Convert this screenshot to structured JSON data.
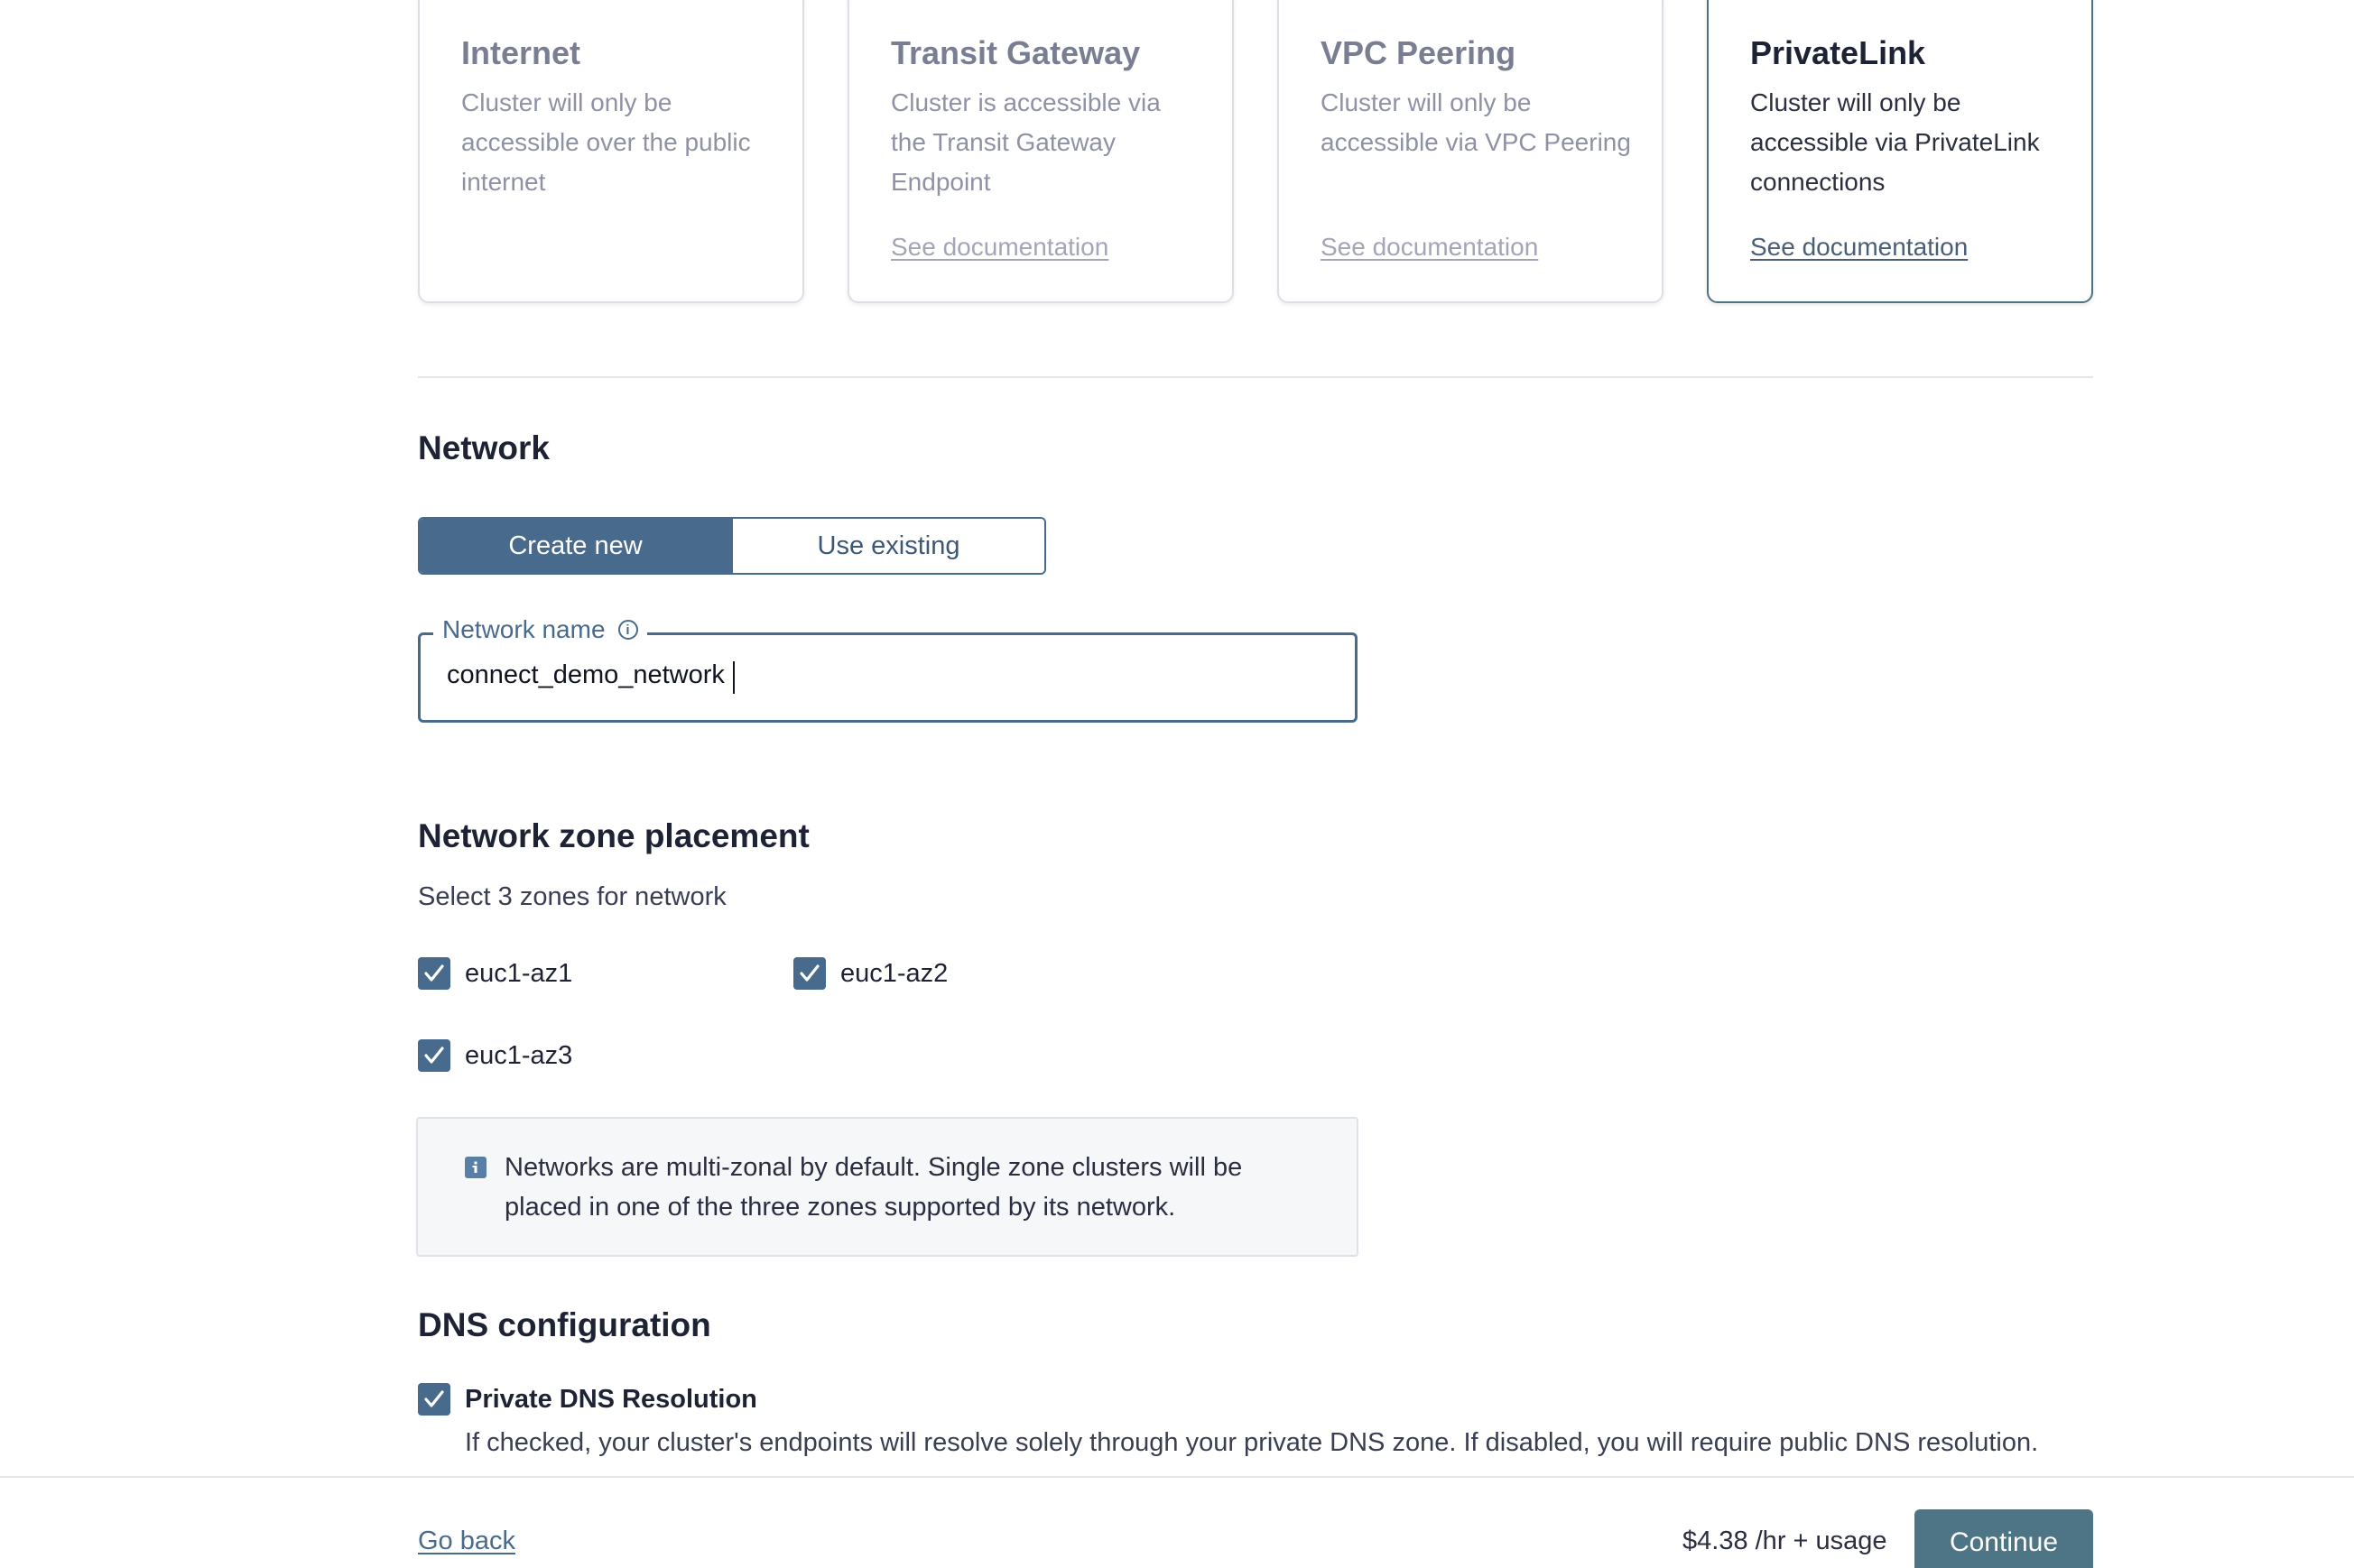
{
  "connectivity": {
    "cards": [
      {
        "title": "Internet",
        "description": "Cluster will only be accessible over the public internet",
        "link": ""
      },
      {
        "title": "Transit Gateway",
        "description": "Cluster is accessible via the Transit Gateway Endpoint",
        "link": "See documentation"
      },
      {
        "title": "VPC Peering",
        "description": "Cluster will only be accessible via VPC Peering",
        "link": "See documentation"
      },
      {
        "title": "PrivateLink",
        "description": "Cluster will only be accessible via PrivateLink connections",
        "link": "See documentation"
      }
    ],
    "selected": "PrivateLink"
  },
  "network": {
    "title": "Network",
    "create_new": "Create new",
    "use_existing": "Use existing",
    "active_option": "Create new",
    "name_label": "Network name",
    "name_value": "connect_demo_network"
  },
  "zones": {
    "title": "Network zone placement",
    "subtitle": "Select 3 zones for network",
    "items": [
      {
        "label": "euc1-az1",
        "checked": true
      },
      {
        "label": "euc1-az2",
        "checked": true
      },
      {
        "label": "euc1-az3",
        "checked": true
      }
    ],
    "info": "Networks are multi-zonal by default. Single zone clusters will be placed in one of the three zones supported by its network."
  },
  "dns": {
    "title": "DNS configuration",
    "option_label": "Private DNS Resolution",
    "option_checked": true,
    "description": "If checked, your cluster's endpoints will resolve solely through your private DNS zone. If disabled, you will require public DNS resolution."
  },
  "footer": {
    "back": "Go back",
    "price": "$4.38 /hr + usage",
    "continue": "Continue"
  },
  "colors": {
    "accent": "#486a8c",
    "selected_card_border": "#4c7284",
    "continue_button": "#4e7585",
    "info_box_bg": "#f6f7f9"
  }
}
